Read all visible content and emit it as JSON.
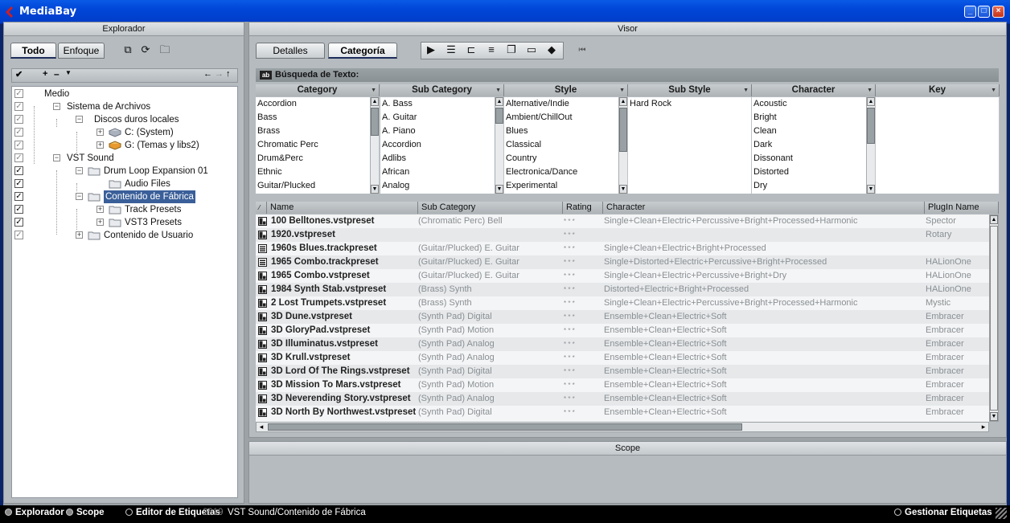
{
  "app": {
    "title": "MediaBay"
  },
  "explorer": {
    "title": "Explorador",
    "tabs": [
      "Todo",
      "Enfoque"
    ],
    "tree": [
      {
        "label": "Medio",
        "level": 0,
        "checked": false
      },
      {
        "label": "Sistema de Archivos",
        "level": 1,
        "checked": false
      },
      {
        "label": "Discos duros locales",
        "level": 2,
        "checked": false
      },
      {
        "label": "C: (System)",
        "level": 3,
        "checked": false
      },
      {
        "label": "G: (Temas y libs2)",
        "level": 3,
        "checked": false
      },
      {
        "label": "VST Sound",
        "level": 1,
        "checked": false
      },
      {
        "label": "Drum Loop Expansion 01",
        "level": 2,
        "checked": true
      },
      {
        "label": "Audio Files",
        "level": 3,
        "checked": true
      },
      {
        "label": "Contenido de Fábrica",
        "level": 2,
        "checked": true,
        "selected": true
      },
      {
        "label": "Track Presets",
        "level": 3,
        "checked": true
      },
      {
        "label": "VST3 Presets",
        "level": 3,
        "checked": true
      },
      {
        "label": "Contenido de Usuario",
        "level": 2,
        "checked": false
      }
    ]
  },
  "viewer": {
    "title": "Visor",
    "tabs": [
      "Detalles",
      "Categoría"
    ],
    "search_label": "Búsqueda de Texto:"
  },
  "filters": [
    {
      "header": "Category",
      "items": [
        "Accordion",
        "Bass",
        "Brass",
        "Chromatic Perc",
        "Drum&Perc",
        "Ethnic",
        "Guitar/Plucked"
      ]
    },
    {
      "header": "Sub Category",
      "items": [
        "A. Bass",
        "A. Guitar",
        "A. Piano",
        "Accordion",
        "Adlibs",
        "African",
        "Analog"
      ]
    },
    {
      "header": "Style",
      "items": [
        "Alternative/Indie",
        "Ambient/ChillOut",
        "Blues",
        "Classical",
        "Country",
        "Electronica/Dance",
        "Experimental"
      ]
    },
    {
      "header": "Sub Style",
      "items": [
        "Hard Rock"
      ]
    },
    {
      "header": "Character",
      "items": [
        "Acoustic",
        "Bright",
        "Clean",
        "Dark",
        "Dissonant",
        "Distorted",
        "Dry"
      ]
    },
    {
      "header": "Key",
      "items": []
    }
  ],
  "results": {
    "columns": [
      "Name",
      "Sub Category",
      "Rating",
      "Character",
      "PlugIn Name"
    ],
    "rating_text": "* * *",
    "rows": [
      {
        "name": "100 Belltones.vstpreset",
        "type": "vst",
        "sub": "(Chromatic Perc) Bell",
        "char": "Single+Clean+Electric+Percussive+Bright+Processed+Harmonic",
        "plug": "Spector"
      },
      {
        "name": "1920.vstpreset",
        "type": "vst",
        "sub": "",
        "char": "",
        "plug": "Rotary"
      },
      {
        "name": "1960s Blues.trackpreset",
        "type": "track",
        "sub": "(Guitar/Plucked) E. Guitar",
        "char": "Single+Clean+Electric+Bright+Processed",
        "plug": ""
      },
      {
        "name": "1965 Combo.trackpreset",
        "type": "track",
        "sub": "(Guitar/Plucked) E. Guitar",
        "char": "Single+Distorted+Electric+Percussive+Bright+Processed",
        "plug": "HALionOne"
      },
      {
        "name": "1965 Combo.vstpreset",
        "type": "vst",
        "sub": "(Guitar/Plucked) E. Guitar",
        "char": "Single+Clean+Electric+Percussive+Bright+Dry",
        "plug": "HALionOne"
      },
      {
        "name": "1984 Synth Stab.vstpreset",
        "type": "vst",
        "sub": "(Brass) Synth",
        "char": "Distorted+Electric+Bright+Processed",
        "plug": "HALionOne"
      },
      {
        "name": "2 Lost Trumpets.vstpreset",
        "type": "vst",
        "sub": "(Brass) Synth",
        "char": "Single+Clean+Electric+Percussive+Bright+Processed+Harmonic",
        "plug": "Mystic"
      },
      {
        "name": "3D Dune.vstpreset",
        "type": "vst",
        "sub": "(Synth Pad) Digital",
        "char": "Ensemble+Clean+Electric+Soft",
        "plug": "Embracer"
      },
      {
        "name": "3D GloryPad.vstpreset",
        "type": "vst",
        "sub": "(Synth Pad) Motion",
        "char": "Ensemble+Clean+Electric+Soft",
        "plug": "Embracer"
      },
      {
        "name": "3D Illuminatus.vstpreset",
        "type": "vst",
        "sub": "(Synth Pad) Analog",
        "char": "Ensemble+Clean+Electric+Soft",
        "plug": "Embracer"
      },
      {
        "name": "3D Krull.vstpreset",
        "type": "vst",
        "sub": "(Synth Pad) Analog",
        "char": "Ensemble+Clean+Electric+Soft",
        "plug": "Embracer"
      },
      {
        "name": "3D Lord Of The Rings.vstpreset",
        "type": "vst",
        "sub": "(Synth Pad) Digital",
        "char": "Ensemble+Clean+Electric+Soft",
        "plug": "Embracer"
      },
      {
        "name": "3D Mission To Mars.vstpreset",
        "type": "vst",
        "sub": "(Synth Pad) Motion",
        "char": "Ensemble+Clean+Electric+Soft",
        "plug": "Embracer"
      },
      {
        "name": "3D Neverending Story.vstpreset",
        "type": "vst",
        "sub": "(Synth Pad) Analog",
        "char": "Ensemble+Clean+Electric+Soft",
        "plug": "Embracer"
      },
      {
        "name": "3D North By Northwest.vstpreset",
        "type": "vst",
        "sub": "(Synth Pad) Digital",
        "char": "Ensemble+Clean+Electric+Soft",
        "plug": "Embracer"
      }
    ]
  },
  "scope": {
    "title": "Scope"
  },
  "statusbar": {
    "explorer": "Explorador",
    "scope": "Scope",
    "tag_editor": "Editor de Etiquetas",
    "count": "2919",
    "path": "VST Sound/Contenido de Fábrica",
    "manage_tags": "Gestionar Etiquetas"
  }
}
